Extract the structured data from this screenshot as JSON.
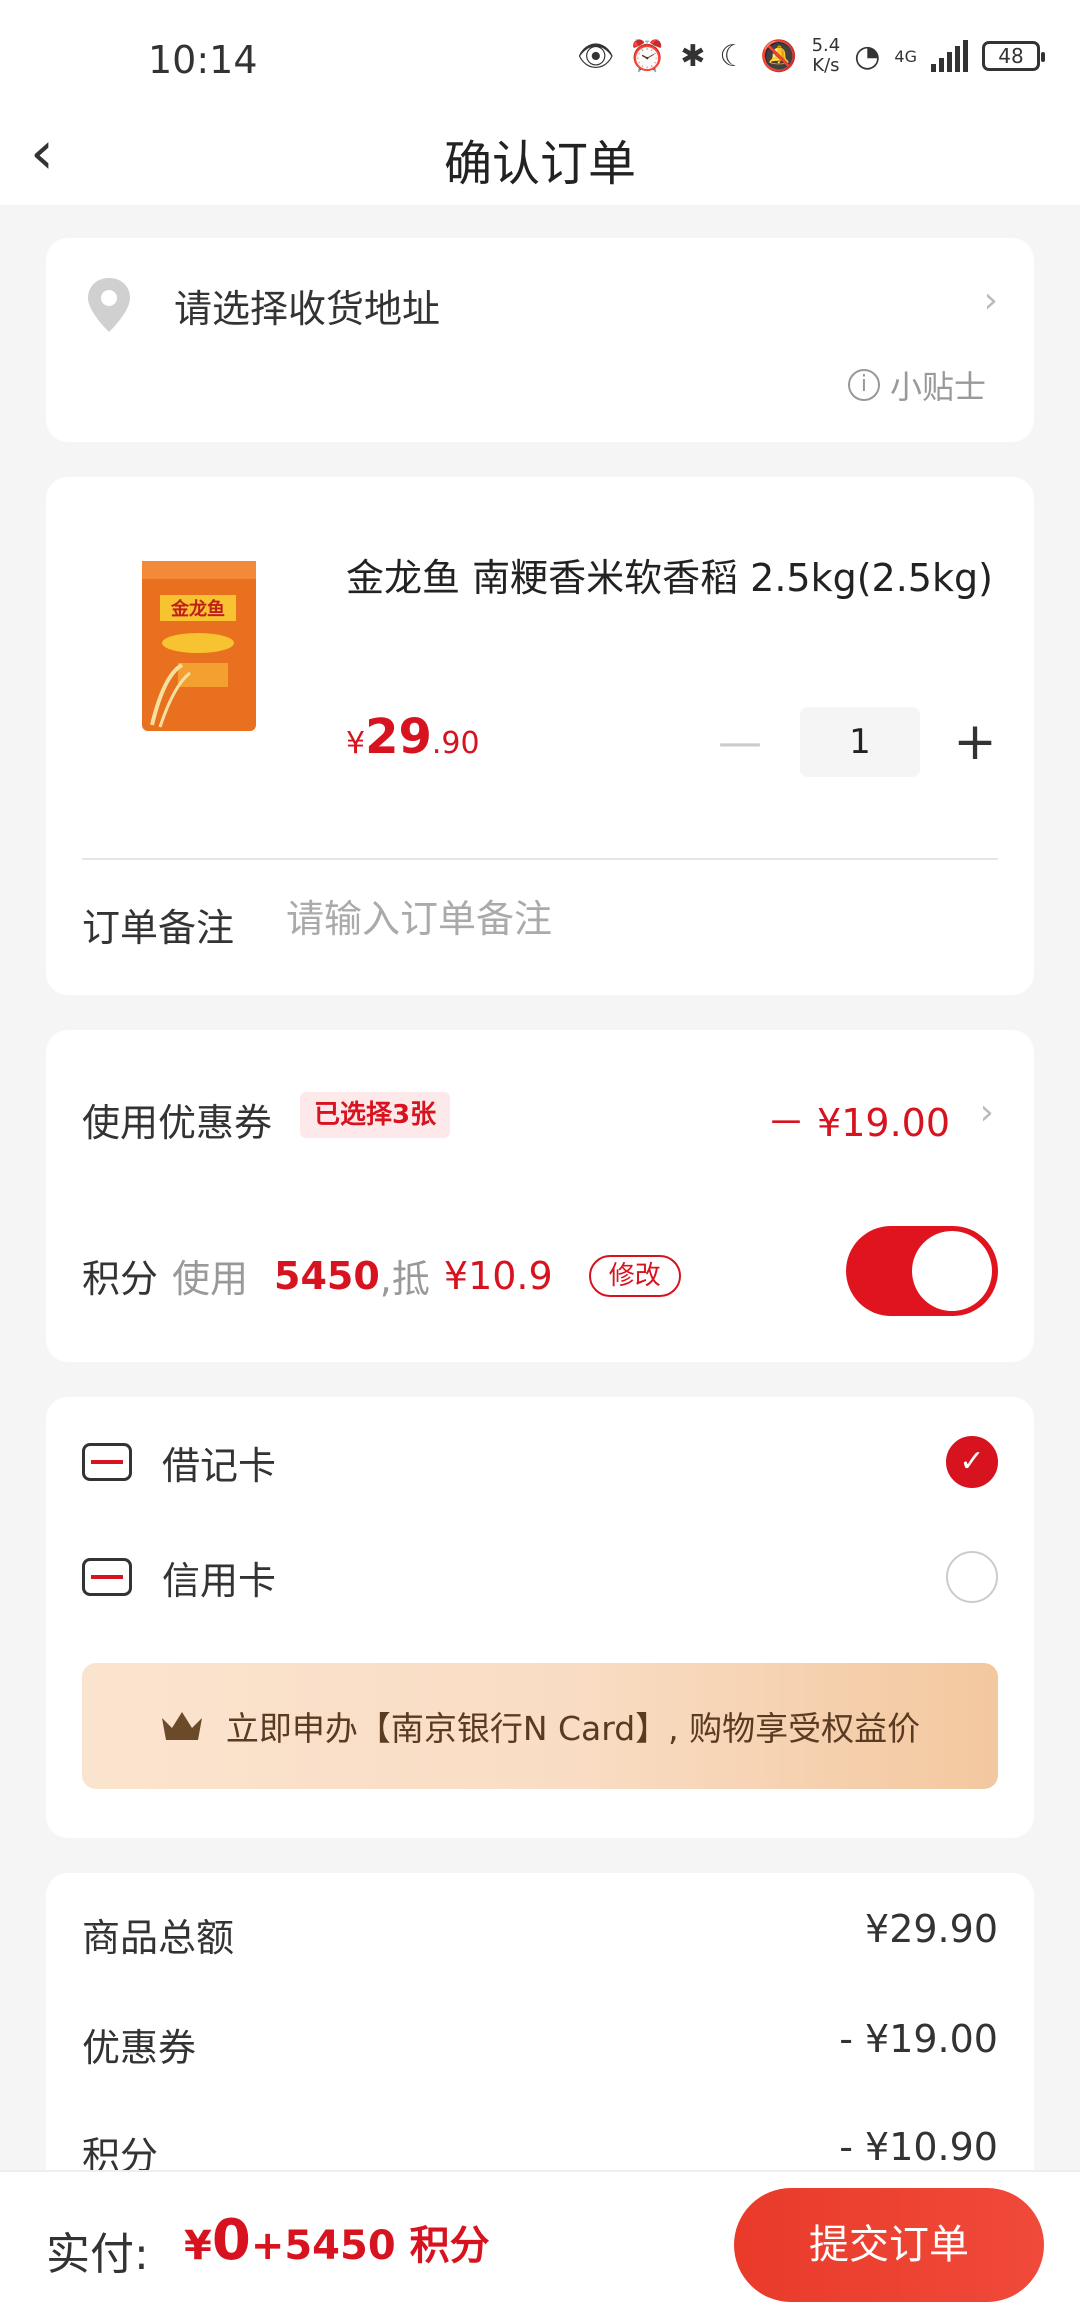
{
  "status_bar": {
    "time": "10:14",
    "net_speed": "5.4",
    "net_unit": "K/s",
    "network": "4G",
    "battery": "48"
  },
  "header": {
    "title": "确认订单"
  },
  "address": {
    "label": "请选择收货地址",
    "tip": "小贴士"
  },
  "product": {
    "name": "金龙鱼 南粳香米软香稻 2.5kg(2.5kg)",
    "currency": "¥",
    "price_int": "29",
    "price_dec": ".90",
    "quantity": "1",
    "remark_label": "订单备注",
    "remark_placeholder": "请输入订单备注"
  },
  "discounts": {
    "coupon_label": "使用优惠券",
    "coupon_badge": "已选择3张",
    "coupon_amount": "－ ¥19.00",
    "points_label": "积分",
    "points_use": "使用",
    "points_value": "5450",
    "points_offset_label": ",抵",
    "points_offset": "¥10.9",
    "modify": "修改",
    "points_enabled": true
  },
  "payment": {
    "methods": [
      {
        "name": "借记卡",
        "selected": true
      },
      {
        "name": "信用卡",
        "selected": false
      }
    ],
    "banner": "立即申办【南京银行N Card】, 购物享受权益价"
  },
  "summary": {
    "rows": [
      {
        "label": "商品总额",
        "value": "¥29.90"
      },
      {
        "label": "优惠券",
        "value": "- ¥19.00"
      },
      {
        "label": "积分",
        "value": "- ¥10.90"
      }
    ]
  },
  "bottom": {
    "pay_label": "实付:",
    "currency": "¥",
    "amount": "0",
    "points_part": "+5450 积分",
    "submit": "提交订单"
  },
  "colors": {
    "accent": "#d7131f",
    "banner": "#f9dcc3"
  }
}
